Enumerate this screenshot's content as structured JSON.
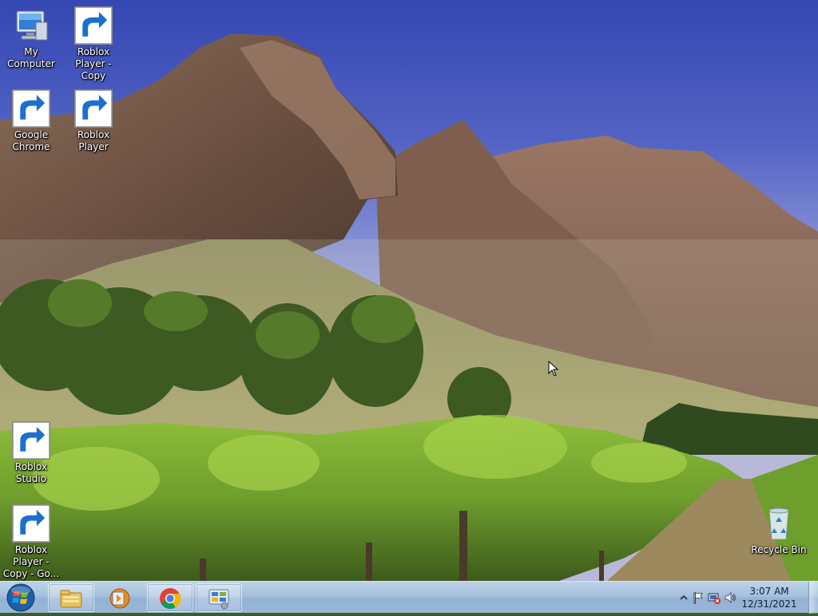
{
  "desktop": {
    "icons": [
      {
        "label": "My Computer",
        "icon": "computer-icon"
      },
      {
        "label": "Roblox Player - Copy",
        "icon": "roblox-player-icon"
      },
      {
        "label": "Google Chrome",
        "icon": "chrome-icon"
      },
      {
        "label": "Roblox Player",
        "icon": "roblox-player-icon"
      },
      {
        "label": "Roblox Studio",
        "icon": "roblox-studio-icon"
      },
      {
        "label": "Roblox Player - Copy - Go...",
        "icon": "roblox-player-icon"
      },
      {
        "label": "Recycle Bin",
        "icon": "recycle-bin-icon"
      }
    ]
  },
  "taskbar": {
    "start": {
      "icon": "windows-start-orb-icon"
    },
    "pinned": [
      {
        "icon": "file-explorer-icon"
      },
      {
        "icon": "media-player-icon"
      },
      {
        "icon": "chrome-icon"
      },
      {
        "icon": "control-panel-icon"
      }
    ],
    "tray": {
      "icons": [
        "show-hidden-icons-chevron",
        "action-center-flag-icon",
        "network-icon",
        "volume-icon"
      ],
      "time": "3:07 AM",
      "date": "12/31/2021"
    }
  },
  "colors": {
    "sky_top": "#3c4fb8",
    "sky_bottom": "#9aa7e0",
    "taskbar": "#a6c0dd",
    "chrome_red": "#db4437",
    "chrome_green": "#0f9d58",
    "chrome_yellow": "#f4b400",
    "chrome_blue": "#4285f4",
    "roblox_studio_blue": "#1ea2f1"
  }
}
